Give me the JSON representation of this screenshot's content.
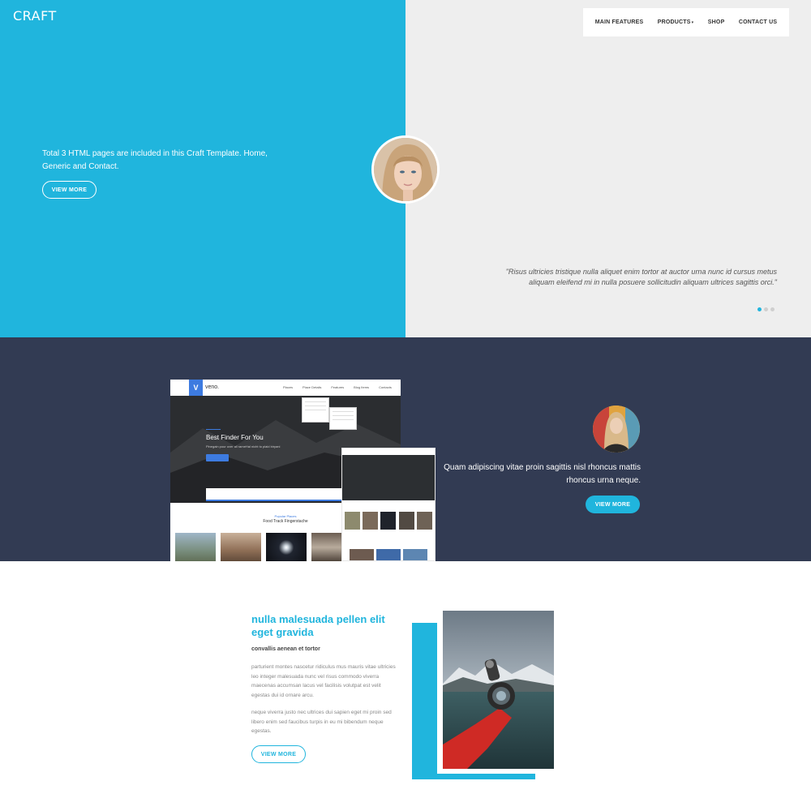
{
  "header": {
    "logo": "CRAFT",
    "nav": [
      {
        "label": "MAIN FEATURES"
      },
      {
        "label": "PRODUCTS"
      },
      {
        "label": "SHOP"
      },
      {
        "label": "CONTACT US"
      }
    ]
  },
  "hero": {
    "text": "Total 3 HTML pages are included in this Craft Template. Home, Generic and Contact.",
    "button": "VIEW MORE",
    "quote": "\"Risus ultricies tristique nulla aliquet enim tortor at auctor urna nunc id cursus metus aliquam eleifend mi in nulla posuere sollicitudin aliquam ultrices sagittis orci.\"",
    "slider_dots": 3,
    "active_dot": 1
  },
  "showcase": {
    "mockup": {
      "logo": "V",
      "brand": "veno.",
      "menu": [
        "Places",
        "Place Details",
        "Features",
        "Blog Items",
        "Contacts"
      ],
      "headline": "Best Finder For You",
      "subline": "Pinegain pour over all rameHal nicht to plaid biryani",
      "section_label": "Popular Places",
      "section_title": "Food Track Fingerstache"
    },
    "text": "Quam adipiscing vitae proin sagittis nisl rhoncus mattis rhoncus urna neque.",
    "button": "VIEW MORE"
  },
  "feature": {
    "title": "nulla malesuada pellen elit eget gravida",
    "subtitle": "convallis aenean et tortor",
    "paragraph1": "parturient montes nascetur ridiculus mus mauris vitae ultricies leo integer malesuada nunc vel risus commodo viverra maecenas accumsan lacus vel facilisis volutpat est velit egestas dui id ornare arcu.",
    "paragraph2": "neque viverra justo nec ultrices dui sapien eget mi proin sed libero enim sed faucibus turpis in eu mi bibendum neque egestas.",
    "button": "VIEW MORE"
  },
  "colors": {
    "accent": "#20b5dd",
    "dark": "#323b53",
    "light_gray": "#eeeeee"
  }
}
